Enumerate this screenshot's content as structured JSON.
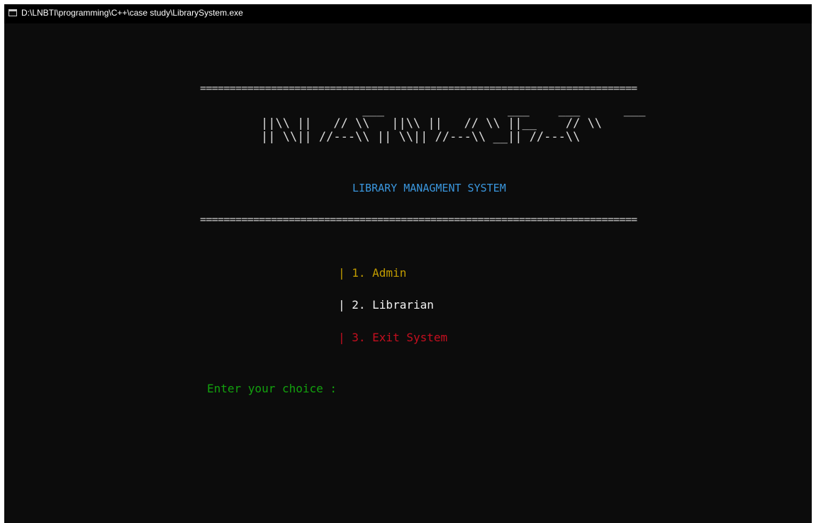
{
  "window": {
    "title": "D:\\LNBTI\\programming\\C++\\case study\\LibrarySystem.exe",
    "icon": "console-app-icon"
  },
  "console": {
    "divider_top": "==========================================================================",
    "logo_art": "              ___                 ___    ___      ___\n||\\\\ ||   // \\\\   ||\\\\ ||   // \\\\ ||__    // \\\\\n|| \\\\|| //---\\\\ || \\\\|| //---\\\\ __|| //---\\\\",
    "subtitle": "LIBRARY MANAGMENT SYSTEM",
    "divider_bottom": "==========================================================================",
    "menu": {
      "admin": "| 1. Admin",
      "librarian": "| 2. Librarian",
      "exit": "| 3. Exit System"
    },
    "prompt": "Enter your choice :"
  },
  "colors": {
    "background": "#0c0c0c",
    "text": "#cccccc",
    "subtitle": "#3a96dd",
    "admin": "#c19c00",
    "librarian": "#f2f2f2",
    "exit": "#c50f1f",
    "prompt": "#13a10e"
  }
}
